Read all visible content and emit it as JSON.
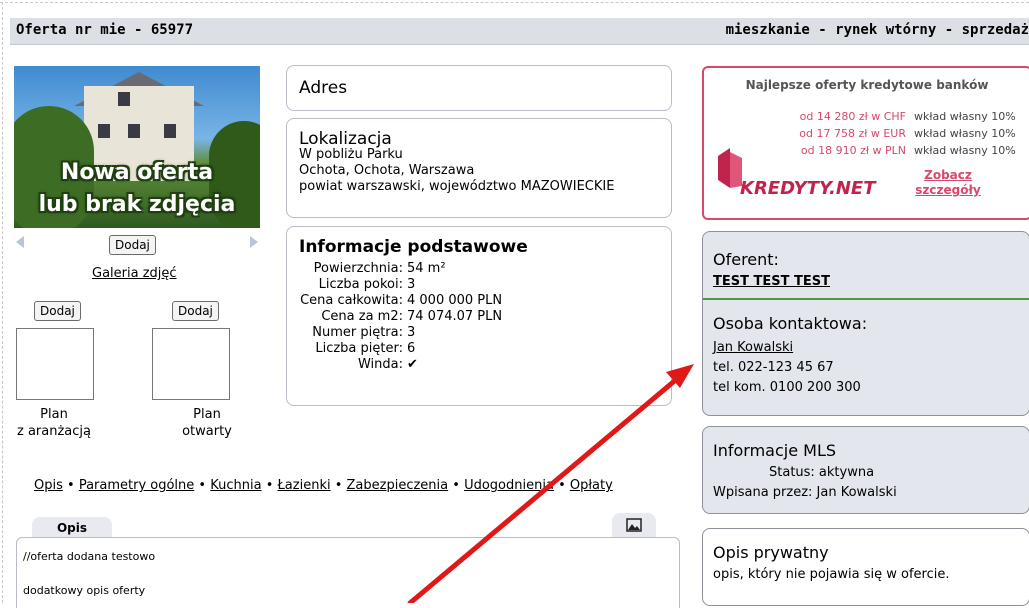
{
  "header": {
    "offer_number": "Oferta nr mie - 65977",
    "offer_type": "mieszkanie - rynek wtórny - sprzedaż"
  },
  "photo": {
    "line1": "Nowa oferta",
    "line2": "lub brak zdjęcia",
    "add_label": "Dodaj",
    "gallery_link": "Galeria zdjęć"
  },
  "plans": [
    {
      "add_label": "Dodaj",
      "caption_line1": "Plan",
      "caption_line2": "z aranżacją"
    },
    {
      "add_label": "Dodaj",
      "caption_line1": "Plan",
      "caption_line2": "otwarty"
    }
  ],
  "address": {
    "title": "Adres"
  },
  "location": {
    "title": "Lokalizacja",
    "line1": "W pobliżu Parku",
    "line2": "Ochota, Ochota, Warszawa",
    "line3": "powiat warszawski, województwo MAZOWIECKIE"
  },
  "basic_info": {
    "title": "Informacje podstawowe",
    "rows": [
      {
        "key": "Powierzchnia:",
        "value": "54 m²"
      },
      {
        "key": "Liczba pokoi:",
        "value": "3"
      },
      {
        "key": "Cena całkowita:",
        "value": "4 000 000 PLN"
      },
      {
        "key": "Cena za m2:",
        "value": "74 074.07 PLN"
      },
      {
        "key": "Numer piętra:",
        "value": "3"
      },
      {
        "key": "Liczba pięter:",
        "value": "6"
      },
      {
        "key": "Winda:",
        "value": "✔"
      }
    ]
  },
  "nav": {
    "items": [
      "Opis",
      "Parametry ogólne",
      "Kuchnia",
      "Łazienki",
      "Zabezpieczenia",
      "Udogodnienia",
      "Opłaty"
    ],
    "separator": " • "
  },
  "description": {
    "tab_label": "Opis",
    "line1": "//oferta dodana testowo",
    "line2": "dodatkowy opis oferty"
  },
  "credit_ad": {
    "title": "Najlepsze oferty kredytowe banków",
    "rows": [
      {
        "amount": "od 14 280 zł w CHF",
        "deposit": "wkład własny 10%"
      },
      {
        "amount": "od 17 758 zł w EUR",
        "deposit": "wkład własny 10%"
      },
      {
        "amount": "od 18 910 zł w PLN",
        "deposit": "wkład własny 10%"
      }
    ],
    "brand": "KREDYTY.NET",
    "more_line1": "Zobacz",
    "more_line2": "szczegóły"
  },
  "offerer": {
    "title": "Oferent:",
    "name": "TEST TEST TEST",
    "contact_title": "Osoba kontaktowa:",
    "contact_name": "Jan Kowalski",
    "phone": "tel. 022-123 45 67",
    "mobile": "tel kom. 0100 200 300"
  },
  "mls": {
    "title": "Informacje MLS",
    "status": "Status: aktywna",
    "entered_by": "Wpisana przez: Jan Kowalski"
  },
  "private_note": {
    "title": "Opis prywatny",
    "text": "opis, który nie pojawia się w ofercie."
  },
  "colors": {
    "accent_red": "#d7486b",
    "panel_gray": "#dfe3ea",
    "arrow": "#e01818"
  }
}
